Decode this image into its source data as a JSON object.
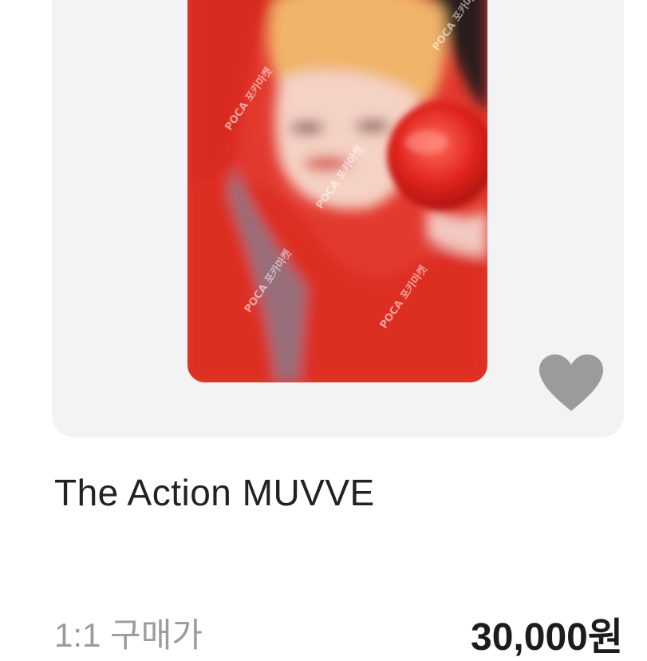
{
  "listing": {
    "title": "The Action MUVVE",
    "price_label": "1:1 구매가",
    "price_value": "30,000원",
    "watermark_text": "POCA 포카마켓",
    "favorite_icon": "heart-icon",
    "favorite_color": "#9b9b9b"
  },
  "colors": {
    "card_background": "#f3f3f5",
    "photo_red": "#e8342c"
  }
}
